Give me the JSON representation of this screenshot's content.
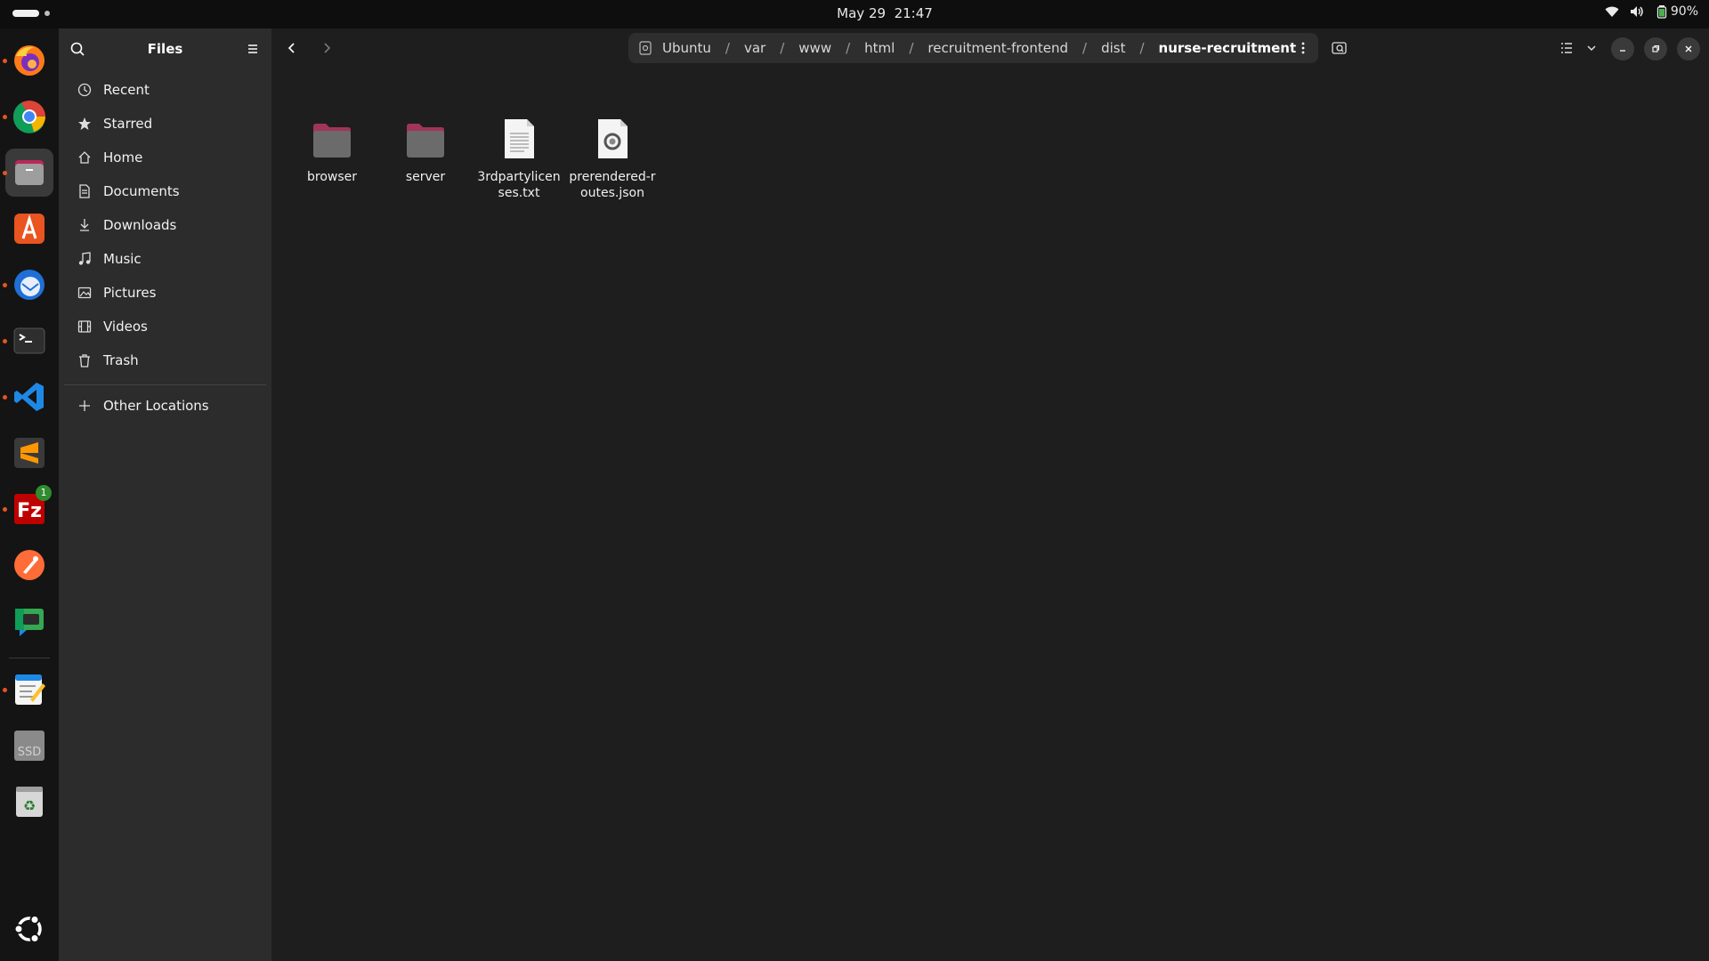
{
  "topbar": {
    "date": "May 29",
    "time": "21:47",
    "battery": "90%",
    "icons": [
      "wifi-icon",
      "volume-icon",
      "battery-icon"
    ]
  },
  "dock": {
    "apps": [
      {
        "name": "firefox",
        "running": true
      },
      {
        "name": "chrome",
        "running": true
      },
      {
        "name": "files",
        "running": true,
        "active": true
      },
      {
        "name": "app-center",
        "running": false
      },
      {
        "name": "thunderbird",
        "running": true
      },
      {
        "name": "terminal",
        "running": true
      },
      {
        "name": "vscode",
        "running": true
      },
      {
        "name": "sublime-text",
        "running": false
      },
      {
        "name": "filezilla",
        "running": true,
        "badge": "1"
      },
      {
        "name": "postman",
        "running": false
      },
      {
        "name": "google-chat",
        "running": false
      },
      {
        "name": "text-editor",
        "running": true
      },
      {
        "name": "ssd-drive",
        "label": "SSD",
        "running": false
      },
      {
        "name": "trash",
        "running": false
      },
      {
        "name": "ubuntu-apps",
        "running": false
      }
    ]
  },
  "sidebar": {
    "title": "Files",
    "items": [
      {
        "label": "Recent",
        "icon": "clock-icon"
      },
      {
        "label": "Starred",
        "icon": "star-icon"
      },
      {
        "label": "Home",
        "icon": "home-icon"
      },
      {
        "label": "Documents",
        "icon": "document-icon"
      },
      {
        "label": "Downloads",
        "icon": "download-icon"
      },
      {
        "label": "Music",
        "icon": "music-icon"
      },
      {
        "label": "Pictures",
        "icon": "picture-icon"
      },
      {
        "label": "Videos",
        "icon": "video-icon"
      },
      {
        "label": "Trash",
        "icon": "trash-icon"
      }
    ],
    "other_locations": "Other Locations"
  },
  "pathbar": {
    "segments": [
      "Ubuntu",
      "var",
      "www",
      "html",
      "recruitment-frontend",
      "dist",
      "nurse-recruitment"
    ],
    "separator": "/"
  },
  "files": [
    {
      "name": "browser",
      "type": "folder"
    },
    {
      "name": "server",
      "type": "folder"
    },
    {
      "name": "3rdpartylicenses.txt",
      "type": "text"
    },
    {
      "name": "prerendered-routes.json",
      "type": "json"
    }
  ],
  "colors": {
    "accent": "#e95420",
    "folder_body": "#6b6b6b",
    "folder_tab": "#a2345a",
    "sidebar_bg": "#2c2c2c",
    "content_bg": "#1e1e1e"
  }
}
